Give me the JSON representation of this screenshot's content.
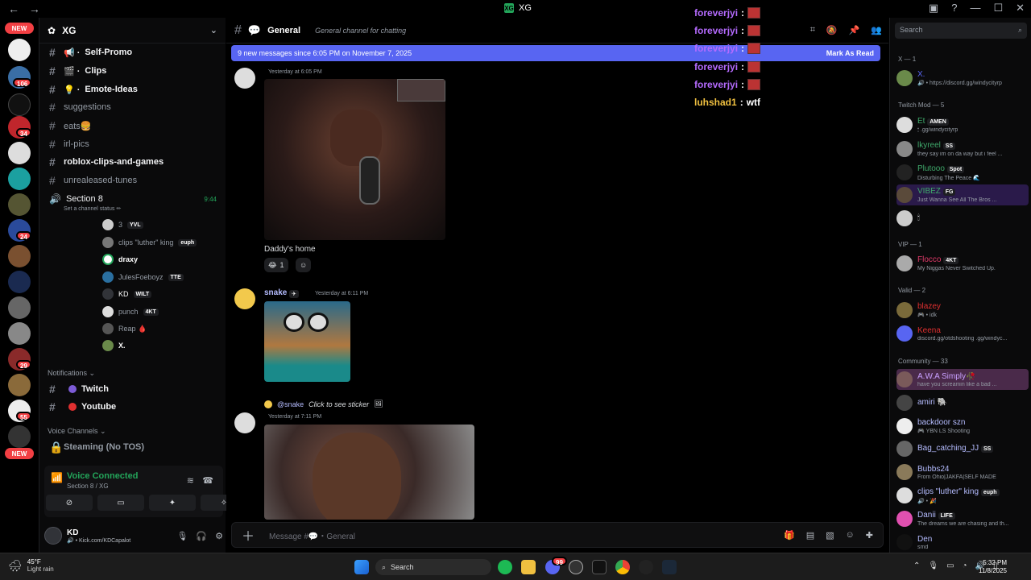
{
  "titlebar": {
    "nav": "← →",
    "server_label": "XG",
    "logo_text": "XG"
  },
  "rail": {
    "new_top": "NEW",
    "new_bottom": "NEW",
    "badges": [
      "106",
      "34",
      "24",
      "29",
      "55"
    ]
  },
  "sidebar": {
    "server_name": "XG",
    "channels": [
      {
        "name": "Self-Promo",
        "bold": true,
        "prefix": "📢 ·"
      },
      {
        "name": "Clips",
        "bold": true,
        "prefix": "🎬 ·"
      },
      {
        "name": "Emote-Ideas",
        "bold": true,
        "prefix": "💡 ·"
      },
      {
        "name": "suggestions",
        "bold": false,
        "prefix": ""
      },
      {
        "name": "eats🍔",
        "bold": false,
        "prefix": ""
      },
      {
        "name": "irl-pics",
        "bold": false,
        "prefix": ""
      },
      {
        "name": "roblox-clips-and-games",
        "bold": true,
        "prefix": ""
      },
      {
        "name": "unrealeased-tunes",
        "bold": false,
        "prefix": ""
      }
    ],
    "voice_channel": {
      "name": "Section 8",
      "time": "9:44",
      "status": "Set a channel status ✏"
    },
    "voice_users": [
      {
        "name": "3",
        "tag": "YVL"
      },
      {
        "name": "clips \"luther\" king",
        "tag": "euph"
      },
      {
        "name": "draxy",
        "tag": ""
      },
      {
        "name": "JulesFoeboyz",
        "tag": "TTE"
      },
      {
        "name": "KD",
        "tag": "WILT"
      },
      {
        "name": "punch",
        "tag": "4KT"
      },
      {
        "name": "Reap 🩸",
        "tag": ""
      },
      {
        "name": "X.",
        "tag": ""
      }
    ],
    "notifications_label": "Notifications ⌄",
    "notif_channels": [
      {
        "name": "Twitch",
        "dot": "#7c5bd6"
      },
      {
        "name": "Youtube",
        "dot": "#e03030"
      }
    ],
    "voice_channels_label": "Voice Channels ⌄",
    "locked_channel": "Steaming (No TOS)",
    "voice_panel": {
      "title": "Voice Connected",
      "sub": "Section 8 / XG"
    },
    "user": {
      "name": "KD",
      "sub": "🔊 • Kick.com/KDCapalot"
    }
  },
  "main": {
    "channel": "General",
    "channel_icon": "💬",
    "topic": "General channel for chatting",
    "banner": "9 new messages since 6:05 PM on November 7, 2025",
    "banner_action": "Mark As Read",
    "messages": [
      {
        "time": "Yesterday at 6:05 PM",
        "text": "Daddy's home",
        "reaction_emoji": "😂",
        "reaction_count": "1"
      },
      {
        "author": "snake",
        "time": "Yesterday at 6:11 PM"
      },
      {
        "reply_to": "@snake",
        "reply_text": "Click to see sticker",
        "time": "Yesterday at 7:11 PM"
      }
    ],
    "composer_placeholder": "Message #💬・General"
  },
  "overlay_chat": [
    {
      "user": "foreverjyi",
      "color": "#b56bff",
      "msg": ""
    },
    {
      "user": "foreverjyi",
      "color": "#b56bff",
      "msg": ""
    },
    {
      "user": "foreverjyi",
      "color": "#b56bff",
      "msg": ""
    },
    {
      "user": "foreverjyi",
      "color": "#b56bff",
      "msg": ""
    },
    {
      "user": "foreverjyi",
      "color": "#b56bff",
      "msg": ""
    },
    {
      "user": "luhshad1",
      "color": "#f0c040",
      "msg": "wtf"
    }
  ],
  "members": {
    "search_placeholder": "Search",
    "groups": [
      {
        "title": "X — 1",
        "members": [
          {
            "name": "X.",
            "status": "🔊 • https://discord.gg/windycityrp",
            "color": "#5865f2",
            "tag": ""
          }
        ]
      },
      {
        "title": "Twitch Mod — 5",
        "members": [
          {
            "name": "Et",
            "status": "🕯 .gg/windycityrp",
            "color": "#3fa96b",
            "tag": "AMEN"
          },
          {
            "name": "lkyreel",
            "status": "they say im on da way but i feel ...",
            "color": "#3fa96b",
            "tag": "SS"
          },
          {
            "name": "Plutooo",
            "status": "Disturbing The Peace 🌊",
            "color": "#3fa96b",
            "tag": "Spot"
          },
          {
            "name": "VIBEZ",
            "status": "Just Wanna See All The Bros ...",
            "color": "#3fa96b",
            "tag": "FG"
          },
          {
            "name": "",
            "status": "",
            "color": "#3fa96b",
            "tag": ""
          }
        ]
      },
      {
        "title": "VIP — 1",
        "members": [
          {
            "name": "Flocco",
            "status": "My Niggas Never Switched Up.",
            "color": "#e03a6a",
            "tag": "4KT"
          }
        ]
      },
      {
        "title": "Valid — 2",
        "members": [
          {
            "name": "blazey",
            "status": "🎮 • idk",
            "color": "#e03030",
            "tag": ""
          },
          {
            "name": "Keena",
            "status": "discord.gg/otdshooting .gg/windyc...",
            "color": "#e03030",
            "tag": ""
          }
        ]
      },
      {
        "title": "Community — 33",
        "members": [
          {
            "name": "A.W.A Simply🥀",
            "status": "have you screamin like a bad ...",
            "color": "#c9a0ff",
            "tag": ""
          },
          {
            "name": "amiri 🐘",
            "status": "",
            "color": "#b5bcff",
            "tag": ""
          },
          {
            "name": "backdoor szn",
            "status": "🎮 YBN LS Shooting",
            "color": "#b5bcff",
            "tag": ""
          },
          {
            "name": "Bag_catching_JJ",
            "status": "",
            "color": "#b5bcff",
            "tag": "SS"
          },
          {
            "name": "Bubbs24",
            "status": "From Ohio|JAKFA|SELF MADE",
            "color": "#b5bcff",
            "tag": ""
          },
          {
            "name": "clips \"luther\" king",
            "status": "🔊 • 🎉",
            "color": "#b5bcff",
            "tag": "euph"
          },
          {
            "name": "Danii",
            "status": "The dreams we are chasing and th...",
            "color": "#b5bcff",
            "tag": "LIFE"
          },
          {
            "name": "Den",
            "status": "smd",
            "color": "#b5bcff",
            "tag": ""
          }
        ]
      }
    ]
  },
  "taskbar": {
    "temp": "45°F",
    "weather": "Light rain",
    "search": "Search",
    "time": "5:32 PM",
    "date": "11/8/2025",
    "discord_badge": "99"
  },
  "colors": {
    "blurple": "#5865f2",
    "green": "#23a55a",
    "red": "#f23f43"
  }
}
